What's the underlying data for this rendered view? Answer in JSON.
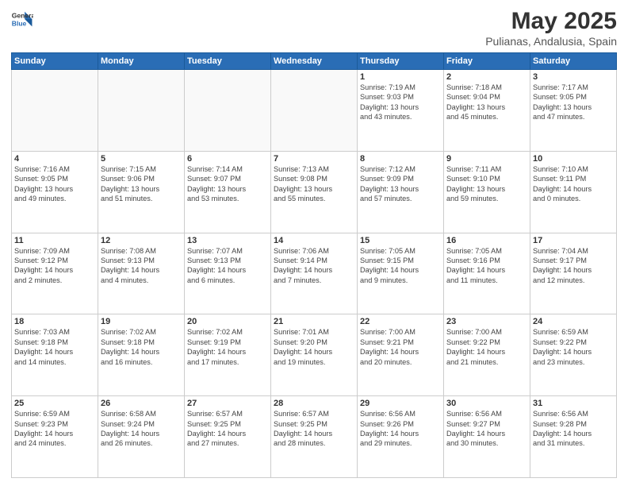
{
  "header": {
    "logo_general": "General",
    "logo_blue": "Blue",
    "title": "May 2025",
    "subtitle": "Pulianas, Andalusia, Spain"
  },
  "weekdays": [
    "Sunday",
    "Monday",
    "Tuesday",
    "Wednesday",
    "Thursday",
    "Friday",
    "Saturday"
  ],
  "weeks": [
    [
      {
        "day": "",
        "info": ""
      },
      {
        "day": "",
        "info": ""
      },
      {
        "day": "",
        "info": ""
      },
      {
        "day": "",
        "info": ""
      },
      {
        "day": "1",
        "info": "Sunrise: 7:19 AM\nSunset: 9:03 PM\nDaylight: 13 hours\nand 43 minutes."
      },
      {
        "day": "2",
        "info": "Sunrise: 7:18 AM\nSunset: 9:04 PM\nDaylight: 13 hours\nand 45 minutes."
      },
      {
        "day": "3",
        "info": "Sunrise: 7:17 AM\nSunset: 9:05 PM\nDaylight: 13 hours\nand 47 minutes."
      }
    ],
    [
      {
        "day": "4",
        "info": "Sunrise: 7:16 AM\nSunset: 9:05 PM\nDaylight: 13 hours\nand 49 minutes."
      },
      {
        "day": "5",
        "info": "Sunrise: 7:15 AM\nSunset: 9:06 PM\nDaylight: 13 hours\nand 51 minutes."
      },
      {
        "day": "6",
        "info": "Sunrise: 7:14 AM\nSunset: 9:07 PM\nDaylight: 13 hours\nand 53 minutes."
      },
      {
        "day": "7",
        "info": "Sunrise: 7:13 AM\nSunset: 9:08 PM\nDaylight: 13 hours\nand 55 minutes."
      },
      {
        "day": "8",
        "info": "Sunrise: 7:12 AM\nSunset: 9:09 PM\nDaylight: 13 hours\nand 57 minutes."
      },
      {
        "day": "9",
        "info": "Sunrise: 7:11 AM\nSunset: 9:10 PM\nDaylight: 13 hours\nand 59 minutes."
      },
      {
        "day": "10",
        "info": "Sunrise: 7:10 AM\nSunset: 9:11 PM\nDaylight: 14 hours\nand 0 minutes."
      }
    ],
    [
      {
        "day": "11",
        "info": "Sunrise: 7:09 AM\nSunset: 9:12 PM\nDaylight: 14 hours\nand 2 minutes."
      },
      {
        "day": "12",
        "info": "Sunrise: 7:08 AM\nSunset: 9:13 PM\nDaylight: 14 hours\nand 4 minutes."
      },
      {
        "day": "13",
        "info": "Sunrise: 7:07 AM\nSunset: 9:13 PM\nDaylight: 14 hours\nand 6 minutes."
      },
      {
        "day": "14",
        "info": "Sunrise: 7:06 AM\nSunset: 9:14 PM\nDaylight: 14 hours\nand 7 minutes."
      },
      {
        "day": "15",
        "info": "Sunrise: 7:05 AM\nSunset: 9:15 PM\nDaylight: 14 hours\nand 9 minutes."
      },
      {
        "day": "16",
        "info": "Sunrise: 7:05 AM\nSunset: 9:16 PM\nDaylight: 14 hours\nand 11 minutes."
      },
      {
        "day": "17",
        "info": "Sunrise: 7:04 AM\nSunset: 9:17 PM\nDaylight: 14 hours\nand 12 minutes."
      }
    ],
    [
      {
        "day": "18",
        "info": "Sunrise: 7:03 AM\nSunset: 9:18 PM\nDaylight: 14 hours\nand 14 minutes."
      },
      {
        "day": "19",
        "info": "Sunrise: 7:02 AM\nSunset: 9:18 PM\nDaylight: 14 hours\nand 16 minutes."
      },
      {
        "day": "20",
        "info": "Sunrise: 7:02 AM\nSunset: 9:19 PM\nDaylight: 14 hours\nand 17 minutes."
      },
      {
        "day": "21",
        "info": "Sunrise: 7:01 AM\nSunset: 9:20 PM\nDaylight: 14 hours\nand 19 minutes."
      },
      {
        "day": "22",
        "info": "Sunrise: 7:00 AM\nSunset: 9:21 PM\nDaylight: 14 hours\nand 20 minutes."
      },
      {
        "day": "23",
        "info": "Sunrise: 7:00 AM\nSunset: 9:22 PM\nDaylight: 14 hours\nand 21 minutes."
      },
      {
        "day": "24",
        "info": "Sunrise: 6:59 AM\nSunset: 9:22 PM\nDaylight: 14 hours\nand 23 minutes."
      }
    ],
    [
      {
        "day": "25",
        "info": "Sunrise: 6:59 AM\nSunset: 9:23 PM\nDaylight: 14 hours\nand 24 minutes."
      },
      {
        "day": "26",
        "info": "Sunrise: 6:58 AM\nSunset: 9:24 PM\nDaylight: 14 hours\nand 26 minutes."
      },
      {
        "day": "27",
        "info": "Sunrise: 6:57 AM\nSunset: 9:25 PM\nDaylight: 14 hours\nand 27 minutes."
      },
      {
        "day": "28",
        "info": "Sunrise: 6:57 AM\nSunset: 9:25 PM\nDaylight: 14 hours\nand 28 minutes."
      },
      {
        "day": "29",
        "info": "Sunrise: 6:56 AM\nSunset: 9:26 PM\nDaylight: 14 hours\nand 29 minutes."
      },
      {
        "day": "30",
        "info": "Sunrise: 6:56 AM\nSunset: 9:27 PM\nDaylight: 14 hours\nand 30 minutes."
      },
      {
        "day": "31",
        "info": "Sunrise: 6:56 AM\nSunset: 9:28 PM\nDaylight: 14 hours\nand 31 minutes."
      }
    ]
  ]
}
